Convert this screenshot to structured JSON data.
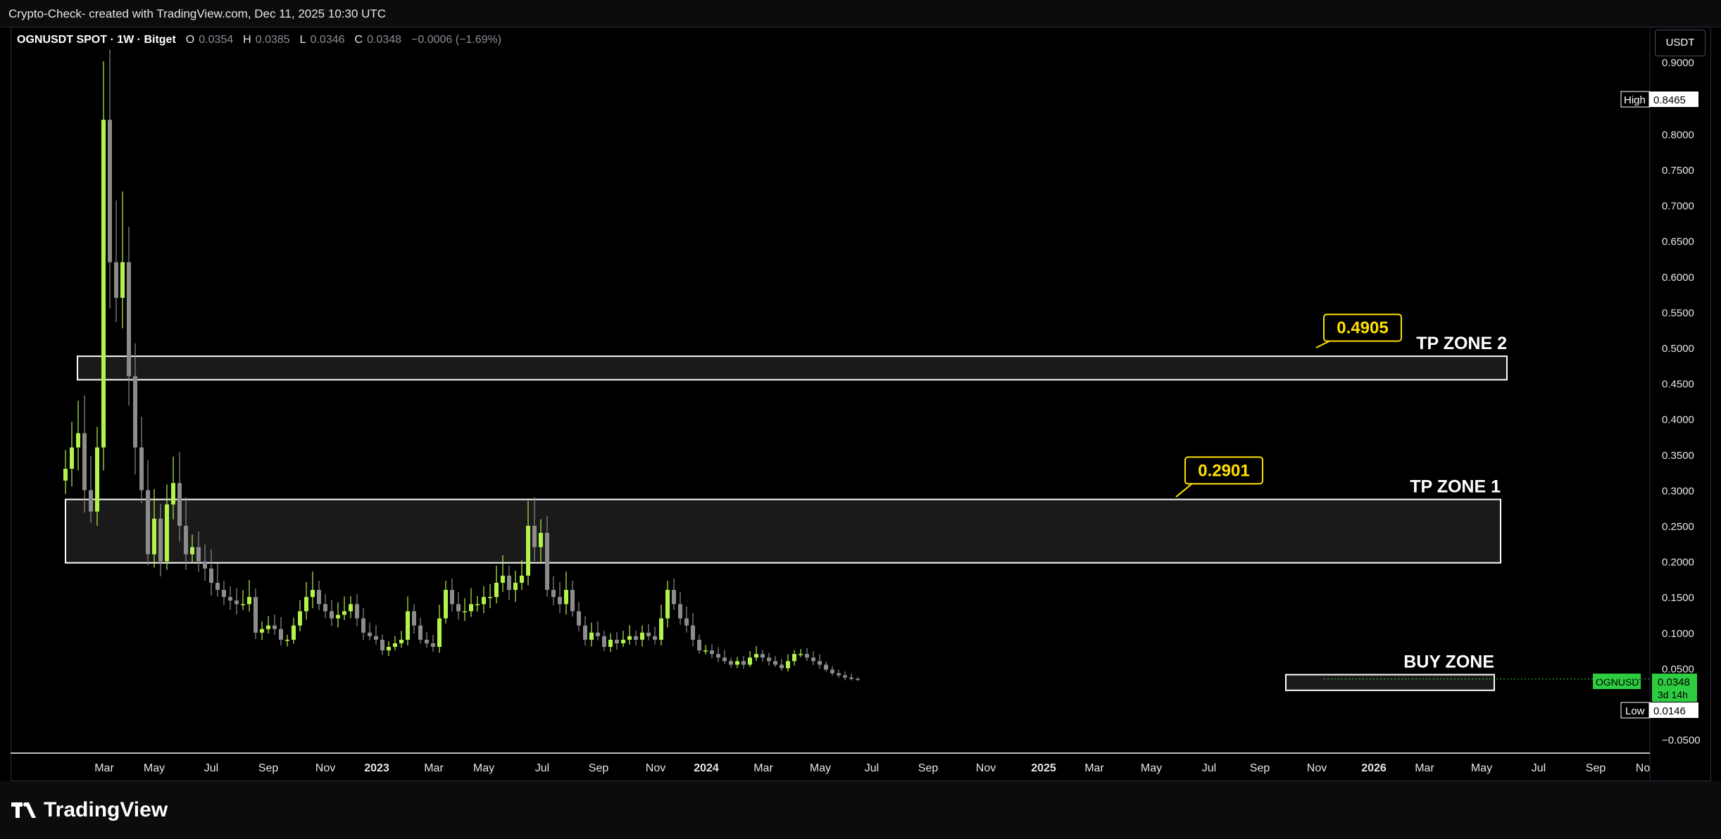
{
  "header": {
    "title": "Crypto-Check- created with TradingView.com, Dec 11, 2025 10:30 UTC"
  },
  "legend": {
    "symbol": "OGNUSDT SPOT · 1W · Bitget",
    "o_label": "O",
    "o_value": "0.0354",
    "h_label": "H",
    "h_value": "0.0385",
    "l_label": "L",
    "l_value": "0.0346",
    "c_label": "C",
    "c_value": "0.0348",
    "change": "−0.0006 (−1.69%)"
  },
  "currency": "USDT",
  "footer": {
    "brand": "TradingView"
  },
  "colors": {
    "up": "#b2f34c",
    "down": "#8c8c8c",
    "background": "#000000",
    "zone_stroke": "#ffffff",
    "callout": "#ffe000",
    "last_price": "#2ecc40"
  },
  "chart_data": {
    "type": "candlestick",
    "y_ticks": [
      "0.9000",
      "0.8000",
      "0.7500",
      "0.7000",
      "0.6500",
      "0.6000",
      "0.5500",
      "0.5000",
      "0.4500",
      "0.4000",
      "0.3500",
      "0.3000",
      "0.2500",
      "0.2000",
      "0.1500",
      "0.1000",
      "0.0500",
      "−0.0500"
    ],
    "x_ticks": [
      "Mar",
      "May",
      "Jul",
      "Sep",
      "Nov",
      "2023",
      "Mar",
      "May",
      "Jul",
      "Sep",
      "Nov",
      "2024",
      "Mar",
      "May",
      "Jul",
      "Sep",
      "Nov",
      "2025",
      "Mar",
      "May",
      "Jul",
      "Sep",
      "Nov",
      "2026",
      "Mar",
      "May",
      "Jul",
      "Sep",
      "No"
    ],
    "zones": [
      {
        "label": "TP ZONE 2",
        "low": 0.455,
        "high": 0.488
      },
      {
        "label": "TP ZONE 1",
        "low": 0.198,
        "high": 0.287
      },
      {
        "label": "BUY ZONE",
        "low": 0.019,
        "high": 0.041
      }
    ],
    "callouts": [
      {
        "text": "0.4905",
        "value": 0.4905
      },
      {
        "text": "0.2901",
        "value": 0.2901
      }
    ],
    "high_marker": {
      "label": "High",
      "value": "0.8465"
    },
    "low_marker": {
      "label": "Low",
      "value": "0.0146"
    },
    "last_price": {
      "symbol": "OGNUSDT",
      "value": "0.0348",
      "countdown": "3d 14h"
    },
    "close_series": [
      0.33,
      0.36,
      0.38,
      0.3,
      0.27,
      0.36,
      0.82,
      0.62,
      0.57,
      0.62,
      0.46,
      0.36,
      0.3,
      0.21,
      0.26,
      0.2,
      0.28,
      0.31,
      0.25,
      0.21,
      0.22,
      0.2,
      0.19,
      0.17,
      0.16,
      0.15,
      0.145,
      0.14,
      0.14,
      0.15,
      0.1,
      0.105,
      0.11,
      0.105,
      0.09,
      0.09,
      0.11,
      0.13,
      0.15,
      0.16,
      0.14,
      0.13,
      0.12,
      0.125,
      0.13,
      0.14,
      0.12,
      0.1,
      0.095,
      0.09,
      0.075,
      0.08,
      0.085,
      0.09,
      0.13,
      0.11,
      0.09,
      0.085,
      0.08,
      0.12,
      0.16,
      0.14,
      0.13,
      0.13,
      0.14,
      0.14,
      0.15,
      0.15,
      0.17,
      0.18,
      0.16,
      0.17,
      0.18,
      0.25,
      0.22,
      0.24,
      0.16,
      0.15,
      0.14,
      0.16,
      0.13,
      0.11,
      0.09,
      0.1,
      0.095,
      0.08,
      0.09,
      0.085,
      0.09,
      0.095,
      0.09,
      0.1,
      0.095,
      0.09,
      0.12,
      0.16,
      0.14,
      0.12,
      0.11,
      0.09,
      0.075,
      0.075,
      0.07,
      0.065,
      0.06,
      0.055,
      0.06,
      0.055,
      0.065,
      0.07,
      0.065,
      0.06,
      0.055,
      0.05,
      0.06,
      0.07,
      0.07,
      0.065,
      0.06,
      0.055,
      0.048,
      0.043,
      0.04,
      0.037,
      0.035,
      0.0348
    ]
  }
}
